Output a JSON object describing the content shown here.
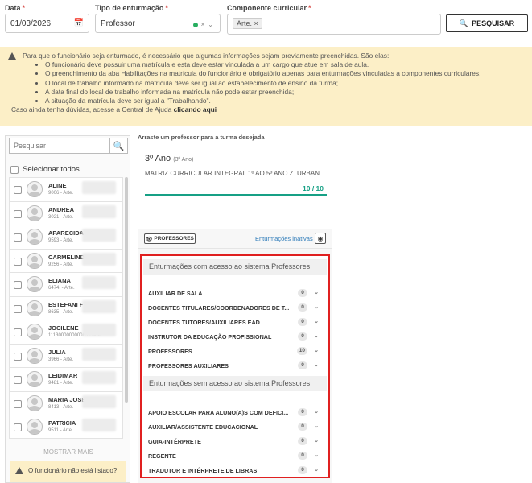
{
  "filters": {
    "data_label": "Data",
    "data_value": "01/03/2026",
    "tipo_label": "Tipo de enturmação",
    "tipo_value": "Professor",
    "componente_label": "Componente curricular",
    "componente_tag": "Arte.",
    "search_button": "PESQUISAR"
  },
  "warning": {
    "intro": "Para que o funcionário seja enturmado, é necessário que algumas informações sejam previamente preenchidas. São elas:",
    "items": [
      "O funcionário deve possuir uma matrícula e esta deve estar vinculada a um cargo que atue em sala de aula.",
      "O preenchimento da aba Habilitações na matrícula do funcionário é obrigatório apenas para enturmações vinculadas a componentes curriculares.",
      "O local de trabalho informado na matrícula deve ser igual ao estabelecimento de ensino da turma;",
      "A data final do local de trabalho informada na matrícula não pode estar preenchida;",
      "A situação da matrícula deve ser igual a \"Trabalhando\"."
    ],
    "tail_text": "Caso ainda tenha dúvidas, acesse a Central de Ajuda",
    "tail_link": "clicando aqui"
  },
  "left": {
    "search_placeholder": "Pesquisar",
    "select_all": "Selecionar todos",
    "people": [
      {
        "name": "ALINE",
        "meta": "9006 - Arte."
      },
      {
        "name": "ANDREA",
        "meta": "3021 - Arte."
      },
      {
        "name": "APARECIDA",
        "meta": "9593 - Arte."
      },
      {
        "name": "CARMELINDA",
        "meta": "9256 - Arte."
      },
      {
        "name": "ELIANA",
        "meta": "6474. - Arte."
      },
      {
        "name": "ESTEFANI F",
        "meta": "8635 - Arte."
      },
      {
        "name": "JOCILENE",
        "meta": "111300000000065 - Arte."
      },
      {
        "name": "JULIA",
        "meta": "3966 - Arte."
      },
      {
        "name": "LEIDIMAR",
        "meta": "9481 - Arte."
      },
      {
        "name": "MARIA JOSE",
        "meta": "8413 - Arte."
      },
      {
        "name": "PATRICIA",
        "meta": "9511 - Arte."
      }
    ],
    "show_more": "MOSTRAR MAIS",
    "notice": "O funcionário não está listado?"
  },
  "middle": {
    "drag_hint": "Arraste um professor para a turma desejada",
    "turma_title": "3º Ano",
    "turma_sub": "(3º Ano)",
    "turma_desc": "MATRIZ CURRICULAR INTEGRAL 1º AO 5º ANO Z. URBAN...",
    "turma_count": "10 / 10",
    "professores_button": "PROFESSORES",
    "inativas_link": "Enturmações inativas",
    "section1_title": "Enturmações com acesso ao sistema Professores",
    "section1_rows": [
      {
        "label": "AUXILIAR DE SALA",
        "count": "0"
      },
      {
        "label": "DOCENTES TITULARES/COORDENADORES DE T...",
        "count": "0"
      },
      {
        "label": "DOCENTES TUTORES/AUXILIARES EAD",
        "count": "0"
      },
      {
        "label": "INSTRUTOR DA EDUCAÇÃO PROFISSIONAL",
        "count": "0"
      },
      {
        "label": "PROFESSORES",
        "count": "10"
      },
      {
        "label": "PROFESSORES AUXILIARES",
        "count": "0"
      }
    ],
    "section2_title": "Enturmações sem acesso ao sistema Professores",
    "section2_rows": [
      {
        "label": "APOIO ESCOLAR PARA ALUNO(A)S COM DEFICI...",
        "count": "0"
      },
      {
        "label": "AUXILIAR/ASSISTENTE EDUCACIONAL",
        "count": "0"
      },
      {
        "label": "GUIA-INTÉRPRETE",
        "count": "0"
      },
      {
        "label": "REGENTE",
        "count": "0"
      },
      {
        "label": "TRADUTOR E INTÉRPRETE DE LIBRAS",
        "count": "0"
      }
    ]
  },
  "colors": {
    "accent_green": "#16a085",
    "warning_bg": "#fcefc7",
    "highlight_red": "#e02020",
    "link_blue": "#2c7ab8"
  }
}
